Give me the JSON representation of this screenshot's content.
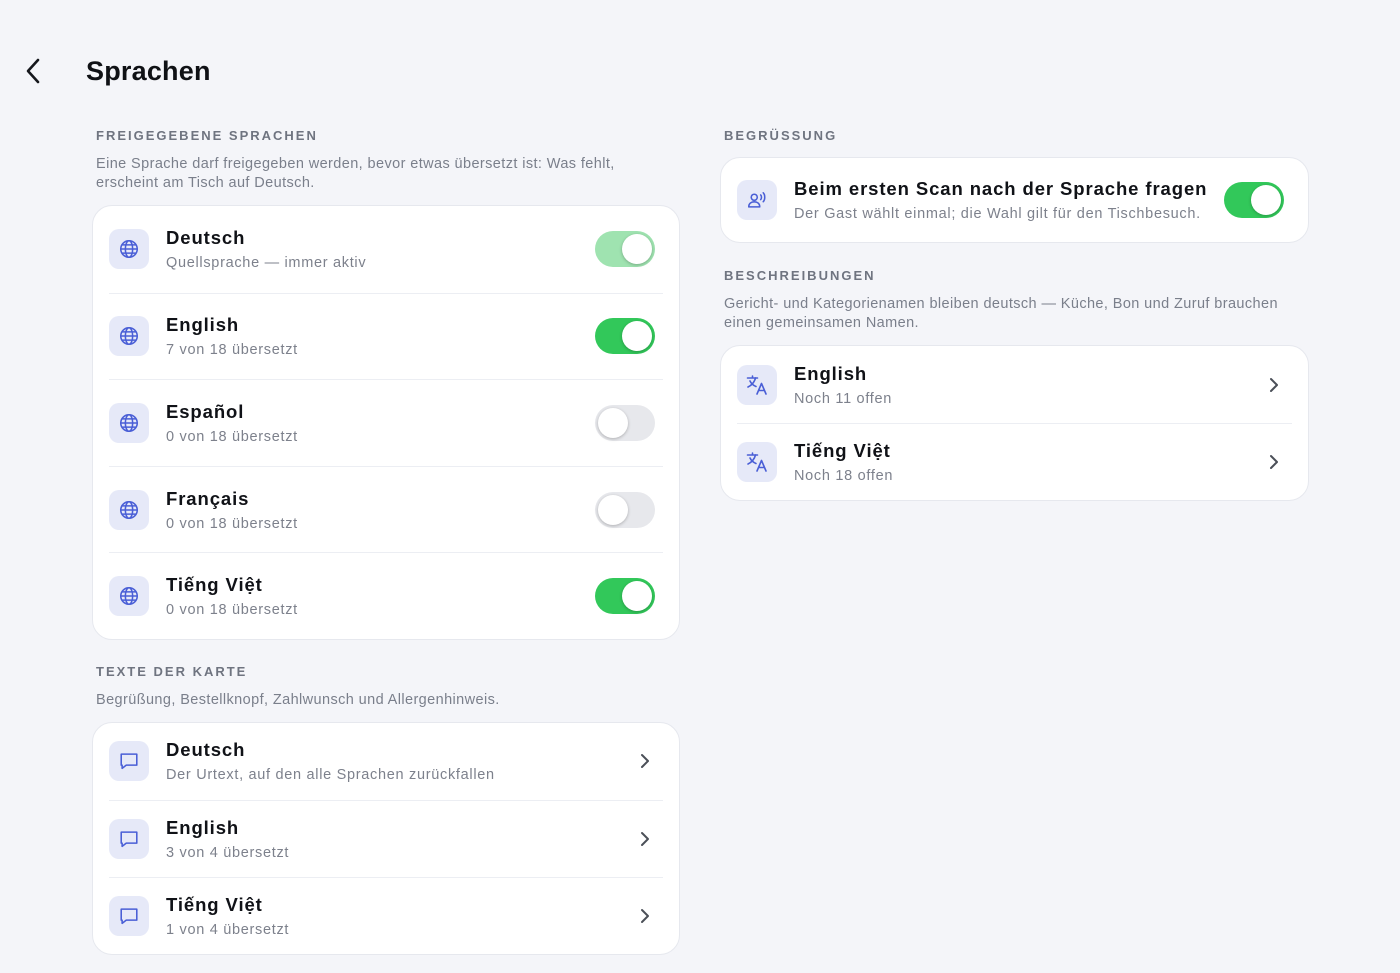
{
  "header": {
    "title": "Sprachen"
  },
  "languages": {
    "label": "FREIGEGEBENE SPRACHEN",
    "description": "Eine Sprache darf freigegeben werden, bevor etwas übersetzt ist: Was fehlt, erscheint am Tisch auf Deutsch.",
    "items": [
      {
        "title": "Deutsch",
        "subtitle": "Quellsprache — immer aktiv",
        "state": "on-locked"
      },
      {
        "title": "English",
        "subtitle": "7 von 18 übersetzt",
        "state": "on"
      },
      {
        "title": "Español",
        "subtitle": "0 von 18 übersetzt",
        "state": "off"
      },
      {
        "title": "Français",
        "subtitle": "0 von 18 übersetzt",
        "state": "off"
      },
      {
        "title": "Tiếng Việt",
        "subtitle": "0 von 18 übersetzt",
        "state": "on"
      }
    ]
  },
  "card_texts": {
    "label": "TEXTE DER KARTE",
    "description": "Begrüßung, Bestellknopf, Zahlwunsch und Allergenhinweis.",
    "items": [
      {
        "title": "Deutsch",
        "subtitle": "Der Urtext, auf den alle Sprachen zurückfallen"
      },
      {
        "title": "English",
        "subtitle": "3 von 4 übersetzt"
      },
      {
        "title": "Tiếng Việt",
        "subtitle": "1 von 4 übersetzt"
      }
    ]
  },
  "greeting": {
    "label": "BEGRÜSSUNG",
    "item": {
      "title": "Beim ersten Scan nach der Sprache fragen",
      "subtitle": "Der Gast wählt einmal; die Wahl gilt für den Tischbesuch.",
      "state": "on"
    }
  },
  "descriptions": {
    "label": "BESCHREIBUNGEN",
    "description": "Gericht- und Kategorienamen bleiben deutsch — Küche, Bon und Zuruf brauchen einen gemeinsamen Namen.",
    "items": [
      {
        "title": "English",
        "subtitle": "Noch 11 offen"
      },
      {
        "title": "Tiếng Việt",
        "subtitle": "Noch 18 offen"
      }
    ]
  },
  "icons": {
    "back": "chevron-left-icon",
    "language": "globe-icon",
    "text": "chat-bubble-icon",
    "greeting": "speaking-person-icon",
    "translate": "translate-icon",
    "row_arrow": "chevron-right-icon"
  },
  "colors": {
    "accent": "#4a5fd6",
    "toggle_on": "#32c85a",
    "toggle_locked": "#9fe3b0",
    "toggle_off": "#e7e8ec",
    "background": "#f4f5f9"
  }
}
